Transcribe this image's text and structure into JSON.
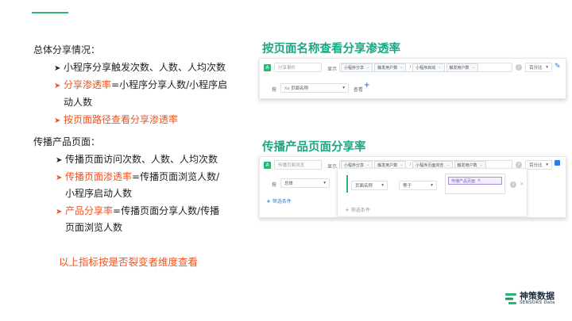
{
  "left": {
    "overall_title": "总体分享情况：",
    "overall_items": [
      "小程序分享触发次数、人数、人均次数",
      "分享渗透率",
      "=小程序分享人数/小程序启",
      "动人数",
      "按页面路径查看分享渗透率"
    ],
    "product_title": "传播产品页面：",
    "product_items": [
      "传播页面访问次数、人数、人均次数",
      "传播页面渗透率",
      "=传播页面浏览人数/",
      "小程序启动人数",
      "产品分享率",
      "=传播页面分享人数/传播",
      "页面浏览人数"
    ],
    "footer_note": "以上指标按是否裂变者维度查看"
  },
  "right": {
    "heading1": "按页面名称查看分享渗透率",
    "heading2": "传播产品页面分享率"
  },
  "panel1": {
    "badge": "A",
    "event_box": "分享事件",
    "show_label": "显示",
    "chips": [
      "小程序分享",
      "触发用户数",
      "小程序启动",
      "触发用户数"
    ],
    "slash": "/",
    "percent_select": "百分比",
    "by_label": "按",
    "page_name_select": "页面名称",
    "view_label": "查看"
  },
  "panel2": {
    "badge": "A",
    "event_box": "传播页面浏览",
    "show_label": "显示",
    "chips": [
      "小程序分享",
      "触发用户数",
      "小程序页面浏览",
      "触发用户数"
    ],
    "slash": "/",
    "percent_select": "百分比",
    "by_label": "按",
    "total_select": "总体",
    "add_condition": "筛选条件",
    "filter_field": "页面名称",
    "filter_op": "等于",
    "filter_tag": "传播产品页面",
    "add_condition2": "筛选条件"
  },
  "logo": {
    "cn": "神策数据",
    "en": "SENSORS Data"
  },
  "colors": {
    "accent_green": "#2bb673",
    "highlight_red": "#f4511e",
    "heading_green": "#1ba784",
    "link_blue": "#2b7de9"
  }
}
